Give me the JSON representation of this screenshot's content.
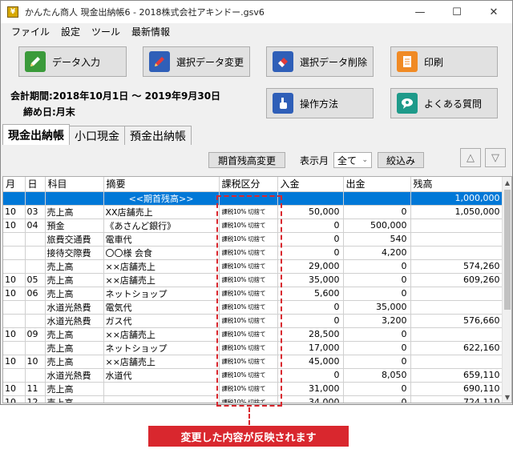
{
  "window": {
    "title": "かんたん商人 現金出納帳6 - 2018株式会社アキンドー.gsv6",
    "minimize": "—",
    "maximize": "☐",
    "close": "✕"
  },
  "menu": [
    "ファイル",
    "設定",
    "ツール",
    "最新情報"
  ],
  "toolbar": {
    "data_entry": "データ入力",
    "edit_selected": "選択データ変更",
    "delete_selected": "選択データ削除",
    "print": "印刷",
    "how_to": "操作方法",
    "faq": "よくある質問"
  },
  "info": {
    "period": "会計期間:2018年10月1日 ～ 2019年9月30日",
    "closing": "締め日:月末"
  },
  "tabs": [
    "現金出納帳",
    "小口現金",
    "預金出納帳"
  ],
  "controls": {
    "opening_balance_btn": "期首残高変更",
    "display_month_label": "表示月",
    "display_month_value": "全て",
    "filter_btn": "絞込み",
    "up_arrow": "△",
    "down_arrow": "▽"
  },
  "table": {
    "headers": [
      "月",
      "日",
      "科目",
      "摘要",
      "課税区分",
      "入金",
      "出金",
      "残高"
    ],
    "opening_row": {
      "label": "<<期首残高>>",
      "balance": "1,000,000"
    },
    "rows": [
      {
        "m": "10",
        "d": "03",
        "account": "売上高",
        "memo": "XX店舗売上",
        "tax": "課税10% 切捨て",
        "in": "50,000",
        "out": "0",
        "bal": "1,050,000"
      },
      {
        "m": "10",
        "d": "04",
        "account": "預金",
        "memo": "《あさんど銀行》",
        "tax": "課税10% 切捨て",
        "in": "0",
        "out": "500,000",
        "bal": ""
      },
      {
        "m": "",
        "d": "",
        "account": "旅費交通費",
        "memo": "電車代",
        "tax": "課税10% 切捨て",
        "in": "0",
        "out": "540",
        "bal": ""
      },
      {
        "m": "",
        "d": "",
        "account": "接待交際費",
        "memo": "〇〇様 会食",
        "tax": "課税10% 切捨て",
        "in": "0",
        "out": "4,200",
        "bal": ""
      },
      {
        "m": "",
        "d": "",
        "account": "売上高",
        "memo": "××店舗売上",
        "tax": "課税10% 切捨て",
        "in": "29,000",
        "out": "0",
        "bal": "574,260"
      },
      {
        "m": "10",
        "d": "05",
        "account": "売上高",
        "memo": "××店舗売上",
        "tax": "課税10% 切捨て",
        "in": "35,000",
        "out": "0",
        "bal": "609,260"
      },
      {
        "m": "10",
        "d": "06",
        "account": "売上高",
        "memo": "ネットショップ",
        "tax": "課税10% 切捨て",
        "in": "5,600",
        "out": "0",
        "bal": ""
      },
      {
        "m": "",
        "d": "",
        "account": "水道光熱費",
        "memo": "電気代",
        "tax": "課税10% 切捨て",
        "in": "0",
        "out": "35,000",
        "bal": ""
      },
      {
        "m": "",
        "d": "",
        "account": "水道光熱費",
        "memo": "ガス代",
        "tax": "課税10% 切捨て",
        "in": "0",
        "out": "3,200",
        "bal": "576,660"
      },
      {
        "m": "10",
        "d": "09",
        "account": "売上高",
        "memo": "××店舗売上",
        "tax": "課税10% 切捨て",
        "in": "28,500",
        "out": "0",
        "bal": ""
      },
      {
        "m": "",
        "d": "",
        "account": "売上高",
        "memo": "ネットショップ",
        "tax": "課税10% 切捨て",
        "in": "17,000",
        "out": "0",
        "bal": "622,160"
      },
      {
        "m": "10",
        "d": "10",
        "account": "売上高",
        "memo": "××店舗売上",
        "tax": "課税10% 切捨て",
        "in": "45,000",
        "out": "0",
        "bal": ""
      },
      {
        "m": "",
        "d": "",
        "account": "水道光熱費",
        "memo": "水道代",
        "tax": "課税10% 切捨て",
        "in": "0",
        "out": "8,050",
        "bal": "659,110"
      },
      {
        "m": "10",
        "d": "11",
        "account": "売上高",
        "memo": "",
        "tax": "課税10% 切捨て",
        "in": "31,000",
        "out": "0",
        "bal": "690,110"
      },
      {
        "m": "10",
        "d": "12",
        "account": "売上高",
        "memo": "",
        "tax": "課税10% 切捨て",
        "in": "34,000",
        "out": "0",
        "bal": "724,110"
      }
    ]
  },
  "callout": "変更した内容が反映されます",
  "colors": {
    "selection": "#0078d7",
    "accent_red": "#d9272e"
  }
}
